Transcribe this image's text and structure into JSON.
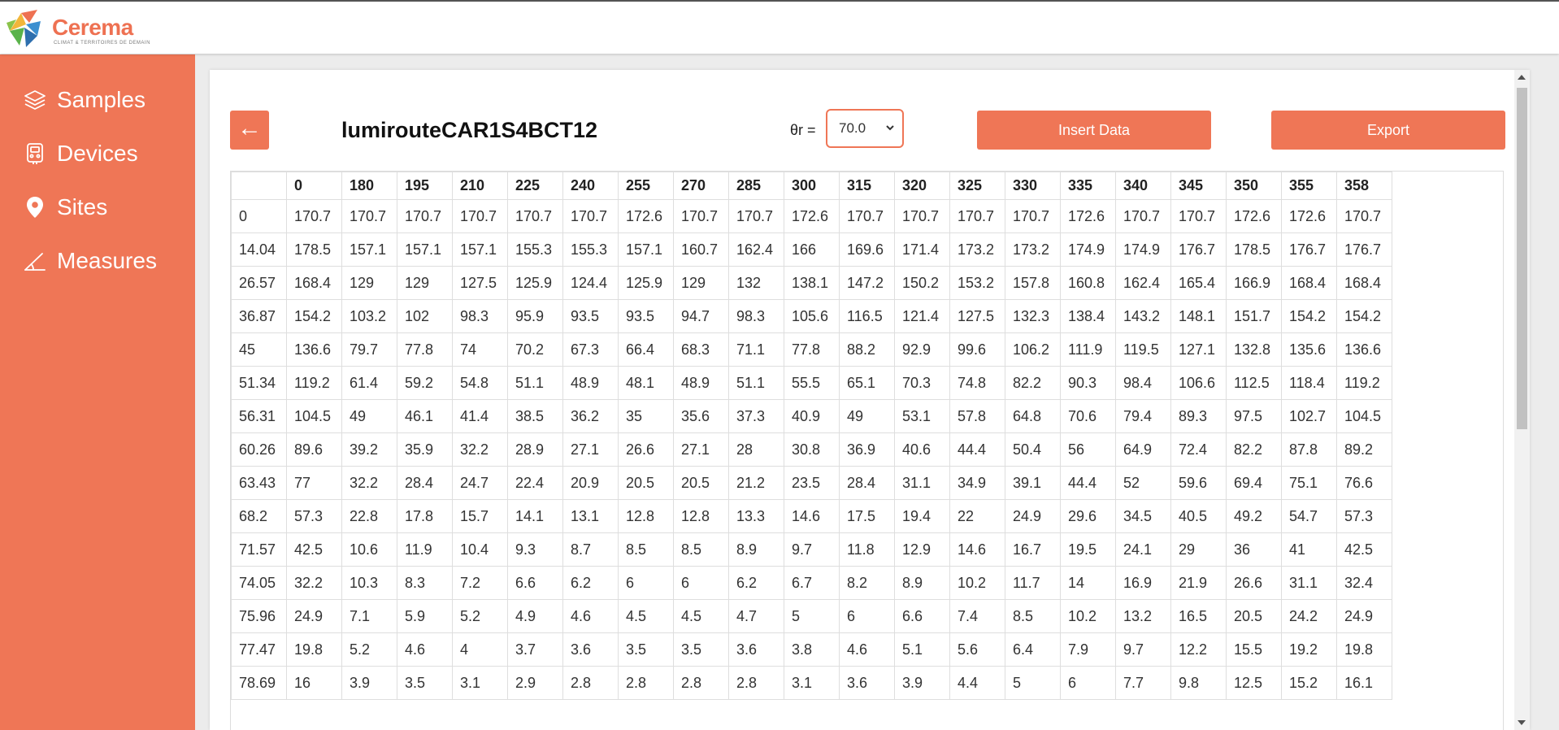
{
  "brand": {
    "name": "Cerema",
    "tagline": "CLIMAT & TERRITOIRES DE DEMAIN",
    "accent_color": "#ef7656"
  },
  "sidebar": {
    "items": [
      {
        "label": "Samples",
        "icon": "layers-icon"
      },
      {
        "label": "Devices",
        "icon": "device-icon"
      },
      {
        "label": "Sites",
        "icon": "location-pin-icon"
      },
      {
        "label": "Measures",
        "icon": "angle-icon"
      }
    ]
  },
  "toolbar": {
    "back_label": "←",
    "sample_name": "lumirouteCAR1S4BCT12",
    "theta_label": "θr =",
    "theta_value": "70.0",
    "insert_label": "Insert Data",
    "export_label": "Export"
  },
  "table": {
    "headers": [
      "",
      "0",
      "180",
      "195",
      "210",
      "225",
      "240",
      "255",
      "270",
      "285",
      "300",
      "315",
      "320",
      "325",
      "330",
      "335",
      "340",
      "345",
      "350",
      "355",
      "358"
    ],
    "rows": [
      [
        "0",
        "170.7",
        "170.7",
        "170.7",
        "170.7",
        "170.7",
        "170.7",
        "172.6",
        "170.7",
        "170.7",
        "172.6",
        "170.7",
        "170.7",
        "170.7",
        "170.7",
        "172.6",
        "170.7",
        "170.7",
        "172.6",
        "172.6",
        "170.7"
      ],
      [
        "14.04",
        "178.5",
        "157.1",
        "157.1",
        "157.1",
        "155.3",
        "155.3",
        "157.1",
        "160.7",
        "162.4",
        "166",
        "169.6",
        "171.4",
        "173.2",
        "173.2",
        "174.9",
        "174.9",
        "176.7",
        "178.5",
        "176.7",
        "176.7"
      ],
      [
        "26.57",
        "168.4",
        "129",
        "129",
        "127.5",
        "125.9",
        "124.4",
        "125.9",
        "129",
        "132",
        "138.1",
        "147.2",
        "150.2",
        "153.2",
        "157.8",
        "160.8",
        "162.4",
        "165.4",
        "166.9",
        "168.4",
        "168.4"
      ],
      [
        "36.87",
        "154.2",
        "103.2",
        "102",
        "98.3",
        "95.9",
        "93.5",
        "93.5",
        "94.7",
        "98.3",
        "105.6",
        "116.5",
        "121.4",
        "127.5",
        "132.3",
        "138.4",
        "143.2",
        "148.1",
        "151.7",
        "154.2",
        "154.2"
      ],
      [
        "45",
        "136.6",
        "79.7",
        "77.8",
        "74",
        "70.2",
        "67.3",
        "66.4",
        "68.3",
        "71.1",
        "77.8",
        "88.2",
        "92.9",
        "99.6",
        "106.2",
        "111.9",
        "119.5",
        "127.1",
        "132.8",
        "135.6",
        "136.6"
      ],
      [
        "51.34",
        "119.2",
        "61.4",
        "59.2",
        "54.8",
        "51.1",
        "48.9",
        "48.1",
        "48.9",
        "51.1",
        "55.5",
        "65.1",
        "70.3",
        "74.8",
        "82.2",
        "90.3",
        "98.4",
        "106.6",
        "112.5",
        "118.4",
        "119.2"
      ],
      [
        "56.31",
        "104.5",
        "49",
        "46.1",
        "41.4",
        "38.5",
        "36.2",
        "35",
        "35.6",
        "37.3",
        "40.9",
        "49",
        "53.1",
        "57.8",
        "64.8",
        "70.6",
        "79.4",
        "89.3",
        "97.5",
        "102.7",
        "104.5"
      ],
      [
        "60.26",
        "89.6",
        "39.2",
        "35.9",
        "32.2",
        "28.9",
        "27.1",
        "26.6",
        "27.1",
        "28",
        "30.8",
        "36.9",
        "40.6",
        "44.4",
        "50.4",
        "56",
        "64.9",
        "72.4",
        "82.2",
        "87.8",
        "89.2"
      ],
      [
        "63.43",
        "77",
        "32.2",
        "28.4",
        "24.7",
        "22.4",
        "20.9",
        "20.5",
        "20.5",
        "21.2",
        "23.5",
        "28.4",
        "31.1",
        "34.9",
        "39.1",
        "44.4",
        "52",
        "59.6",
        "69.4",
        "75.1",
        "76.6"
      ],
      [
        "68.2",
        "57.3",
        "22.8",
        "17.8",
        "15.7",
        "14.1",
        "13.1",
        "12.8",
        "12.8",
        "13.3",
        "14.6",
        "17.5",
        "19.4",
        "22",
        "24.9",
        "29.6",
        "34.5",
        "40.5",
        "49.2",
        "54.7",
        "57.3"
      ],
      [
        "71.57",
        "42.5",
        "10.6",
        "11.9",
        "10.4",
        "9.3",
        "8.7",
        "8.5",
        "8.5",
        "8.9",
        "9.7",
        "11.8",
        "12.9",
        "14.6",
        "16.7",
        "19.5",
        "24.1",
        "29",
        "36",
        "41",
        "42.5"
      ],
      [
        "74.05",
        "32.2",
        "10.3",
        "8.3",
        "7.2",
        "6.6",
        "6.2",
        "6",
        "6",
        "6.2",
        "6.7",
        "8.2",
        "8.9",
        "10.2",
        "11.7",
        "14",
        "16.9",
        "21.9",
        "26.6",
        "31.1",
        "32.4"
      ],
      [
        "75.96",
        "24.9",
        "7.1",
        "5.9",
        "5.2",
        "4.9",
        "4.6",
        "4.5",
        "4.5",
        "4.7",
        "5",
        "6",
        "6.6",
        "7.4",
        "8.5",
        "10.2",
        "13.2",
        "16.5",
        "20.5",
        "24.2",
        "24.9"
      ],
      [
        "77.47",
        "19.8",
        "5.2",
        "4.6",
        "4",
        "3.7",
        "3.6",
        "3.5",
        "3.5",
        "3.6",
        "3.8",
        "4.6",
        "5.1",
        "5.6",
        "6.4",
        "7.9",
        "9.7",
        "12.2",
        "15.5",
        "19.2",
        "19.8"
      ],
      [
        "78.69",
        "16",
        "3.9",
        "3.5",
        "3.1",
        "2.9",
        "2.8",
        "2.8",
        "2.8",
        "2.8",
        "3.1",
        "3.6",
        "3.9",
        "4.4",
        "5",
        "6",
        "7.7",
        "9.8",
        "12.5",
        "15.2",
        "16.1"
      ]
    ]
  }
}
